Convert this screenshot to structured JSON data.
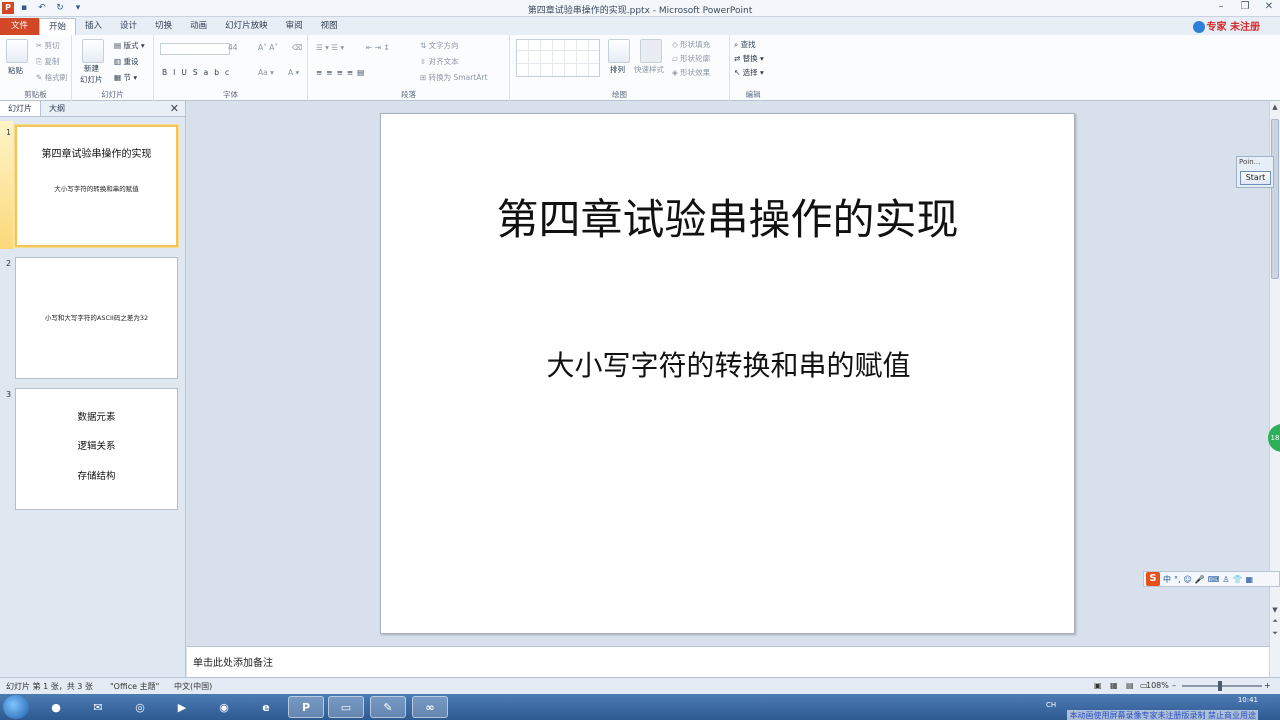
{
  "window": {
    "title": "第四章试验串操作的实现.pptx - Microsoft PowerPoint",
    "app_icon": "P"
  },
  "tabs": [
    "文件",
    "开始",
    "插入",
    "设计",
    "切换",
    "动画",
    "幻灯片放映",
    "审阅",
    "视图"
  ],
  "watermark_top": "专家 未注册",
  "ribbon": {
    "clipboard": {
      "paste": "粘贴",
      "cut": "剪切",
      "copy": "复制",
      "format_painter": "格式刷",
      "label": "剪贴板"
    },
    "slides": {
      "new_slide_line1": "新建",
      "new_slide_line2": "幻灯片",
      "layout": "版式",
      "reset": "重设",
      "section": "节",
      "label": "幻灯片"
    },
    "font": {
      "size": "44",
      "label": "字体"
    },
    "paragraph": {
      "text_direction": "文字方向",
      "align_text": "对齐文本",
      "smartart": "转换为 SmartArt",
      "label": "段落"
    },
    "drawing": {
      "arrange": "排列",
      "quick_styles": "快速样式",
      "shape_fill": "形状填充",
      "shape_outline": "形状轮廓",
      "shape_effects": "形状效果",
      "label": "绘图"
    },
    "editing": {
      "find": "查找",
      "replace": "替换",
      "select": "选择",
      "label": "编辑"
    }
  },
  "panel": {
    "tab_slides": "幻灯片",
    "tab_outline": "大纲",
    "thumbs": [
      {
        "num": "1",
        "title": "第四章试验串操作的实现",
        "sub": "大小写字符的转换和串的赋值"
      },
      {
        "num": "2",
        "title": "",
        "sub": "小写和大写字符的ASCII码之差为32"
      },
      {
        "num": "3",
        "lines": [
          "数据元素",
          "逻辑关系",
          "存储结构"
        ]
      }
    ]
  },
  "slide": {
    "title": "第四章试验串操作的实现",
    "subtitle": "大小写字符的转换和串的赋值"
  },
  "notes_placeholder": "单击此处添加备注",
  "pointer_widget": {
    "label": "Poin...",
    "start": "Start"
  },
  "green_badge": "18",
  "ime": {
    "chars": "中",
    "punct": "°,"
  },
  "status": {
    "slide_info": "幻灯片 第 1 张，共 3 张",
    "theme": "\"Office 主题\"",
    "language": "中文(中国)",
    "zoom": "108%"
  },
  "taskbar": {
    "clock": "10:41",
    "lang": "CH",
    "watermark_bottom": "本动画使用屏幕录像专家未注册版录制 禁止商业用途"
  }
}
